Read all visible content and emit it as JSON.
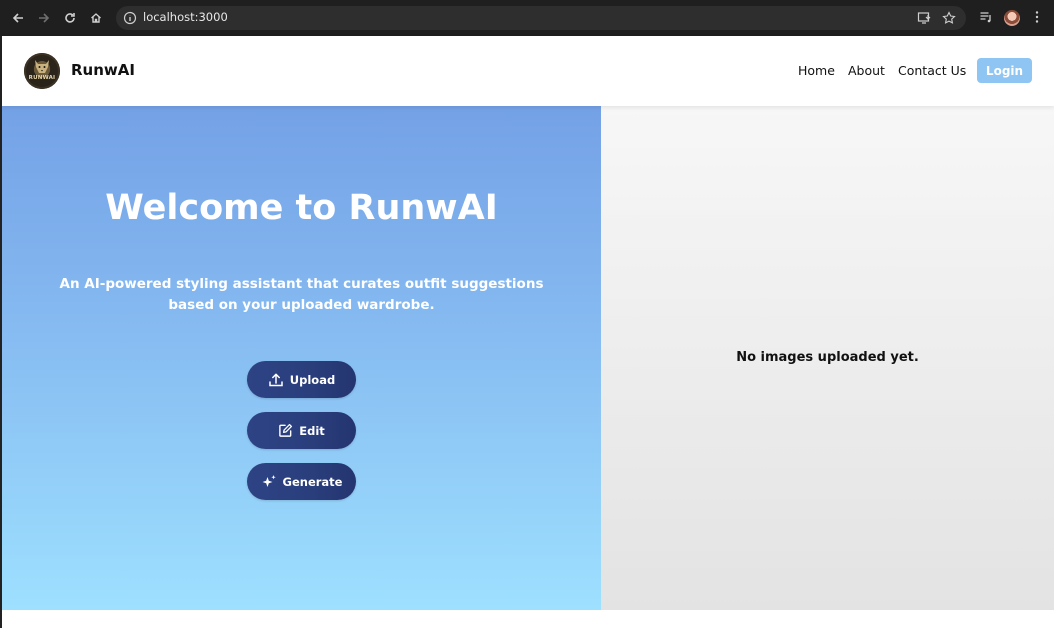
{
  "browser": {
    "url": "localhost:3000",
    "icons": [
      "back-arrow-icon",
      "forward-arrow-icon",
      "reload-icon",
      "home-icon",
      "info-icon",
      "install-app-icon",
      "bookmark-star-icon",
      "media-queue-icon",
      "profile-avatar",
      "kebab-menu-icon"
    ]
  },
  "header": {
    "brand": "RunwAI",
    "logo_text": "RUNWAI",
    "nav": [
      "Home",
      "About",
      "Contact Us"
    ],
    "login_label": "Login",
    "login_color": "#8ec5f2"
  },
  "hero": {
    "title": "Welcome to RunwAI",
    "subtitle": "An AI-powered styling assistant that curates outfit suggestions based on your uploaded wardrobe.",
    "buttons": [
      {
        "label": "Upload",
        "icon": "upload-icon"
      },
      {
        "label": "Edit",
        "icon": "edit-icon"
      },
      {
        "label": "Generate",
        "icon": "sparkle-icon"
      }
    ],
    "gradient_top": "#74a1e6",
    "gradient_bottom": "#9ee0ff",
    "button_color": "#2a3e7c"
  },
  "gallery": {
    "empty_message": "No images uploaded yet."
  }
}
